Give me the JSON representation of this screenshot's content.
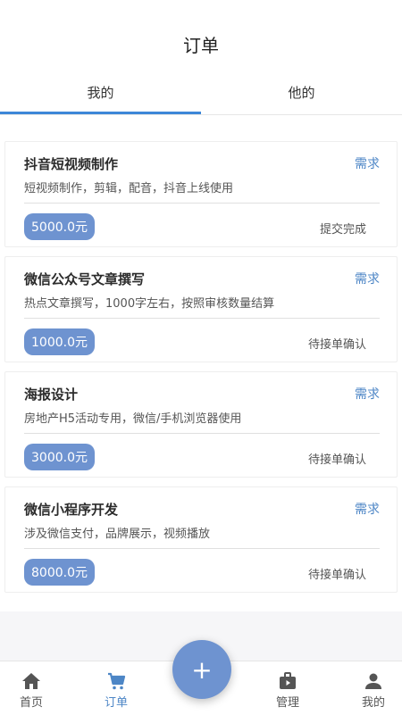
{
  "header": {
    "title": "订单"
  },
  "tabs": [
    {
      "label": "我的",
      "active": true
    },
    {
      "label": "他的",
      "active": false
    }
  ],
  "orders": [
    {
      "title": "抖音短视频制作",
      "tag": "需求",
      "desc": "短视频制作，剪辑，配音，抖音上线使用",
      "price": "5000.0元",
      "status": "提交完成"
    },
    {
      "title": "微信公众号文章撰写",
      "tag": "需求",
      "desc": "热点文章撰写，1000字左右，按照审核数量结算",
      "price": "1000.0元",
      "status": "待接单确认"
    },
    {
      "title": "海报设计",
      "tag": "需求",
      "desc": "房地产H5活动专用，微信/手机浏览器使用",
      "price": "3000.0元",
      "status": "待接单确认"
    },
    {
      "title": "微信小程序开发",
      "tag": "需求",
      "desc": "涉及微信支付，品牌展示，视频播放",
      "price": "8000.0元",
      "status": "待接单确认"
    }
  ],
  "bottom_nav": [
    {
      "label": "首页",
      "icon": "home-icon"
    },
    {
      "label": "订单",
      "icon": "cart-icon",
      "active": true
    },
    {
      "label": "管理",
      "icon": "briefcase-icon"
    },
    {
      "label": "我的",
      "icon": "user-icon"
    }
  ],
  "fab": {
    "label": "+"
  },
  "colors": {
    "accent": "#6e93d0",
    "tab_underline": "#3d87d8",
    "link": "#4d86c6"
  }
}
